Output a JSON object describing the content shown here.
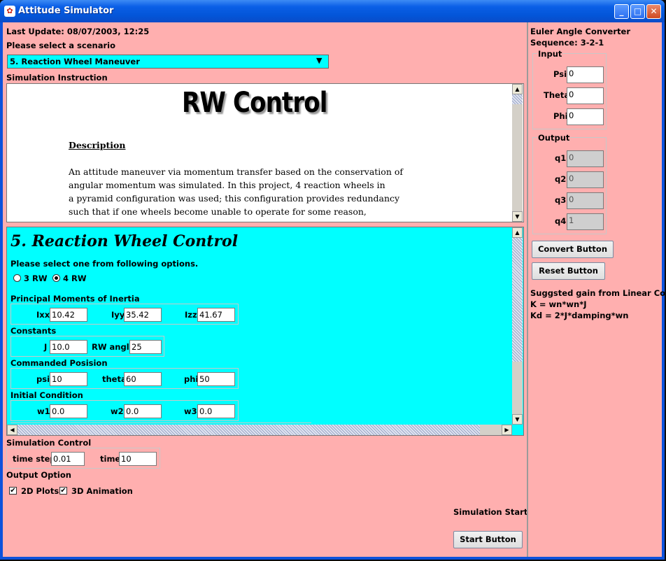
{
  "window": {
    "title": "Attitude Simulator",
    "icon": "app-icon",
    "minimize": "_",
    "maximize": "□",
    "close": "✕"
  },
  "left": {
    "last_update": "Last Update: 08/07/2003, 12:25",
    "select_prompt": "Please select a scenario",
    "scenario_selected": "5. Reaction Wheel Maneuver",
    "instruction_label": "Simulation Instruction",
    "doc": {
      "heading": "RW Control",
      "desc_title": "Description",
      "lines": [
        "An attitude maneuver via momentum transfer based on the conservation of",
        "angular momentum was simulated. In this project, 4 reaction wheels in",
        "a pyramid configuration was used; this configuration provides redundancy",
        "such that if one wheels become unable to operate for some reason,"
      ]
    },
    "panel": {
      "title": "5. Reaction Wheel Control",
      "options_prompt": "Please select one from following options.",
      "radio": [
        {
          "label": "3 RW",
          "selected": false
        },
        {
          "label": "4 RW",
          "selected": true
        }
      ],
      "inertia_title": "Principal Moments of Inertia",
      "inertia": [
        {
          "label": "Ixx",
          "value": "10.42"
        },
        {
          "label": "Iyy",
          "value": "35.42"
        },
        {
          "label": "Izz",
          "value": "41.67"
        }
      ],
      "constants_title": "Constants",
      "constants": [
        {
          "label": "J",
          "value": "10.0"
        },
        {
          "label": "RW angle",
          "value": "25"
        }
      ],
      "commanded_title": "Commanded Posision",
      "commanded": [
        {
          "label": "psi",
          "value": "10"
        },
        {
          "label": "theta",
          "value": "60"
        },
        {
          "label": "phi",
          "value": "50"
        }
      ],
      "initial_title": "Initial Condition",
      "initial": [
        {
          "label": "w1",
          "value": "0.0"
        },
        {
          "label": "w2",
          "value": "0.0"
        },
        {
          "label": "w3",
          "value": "0.0"
        }
      ]
    },
    "sim_control_title": "Simulation Control",
    "time_step_label": "time step",
    "time_step": "0.01",
    "time_label": "time",
    "time": "10",
    "output_option_title": "Output Option",
    "plots_label": "2D Plots",
    "plots_checked": true,
    "anim_label": "3D Animation",
    "anim_checked": true,
    "sim_start_label": "Simulation Start",
    "start_button": "Start Button"
  },
  "right": {
    "title": "Euler Angle Converter",
    "sequence": "Sequence: 3-2-1",
    "input_title": "Input",
    "inputs": [
      {
        "label": "Psi",
        "value": "0"
      },
      {
        "label": "Theta",
        "value": "0"
      },
      {
        "label": "Phi",
        "value": "0"
      }
    ],
    "output_title": "Output",
    "outputs": [
      {
        "label": "q1",
        "value": "0"
      },
      {
        "label": "q2",
        "value": "0"
      },
      {
        "label": "q3",
        "value": "0"
      },
      {
        "label": "q4",
        "value": "1"
      }
    ],
    "convert_button": "Convert Button",
    "reset_button": "Reset Button",
    "gain_title": "Suggsted gain from Linear Cont...",
    "gain_k": "K = wn*wn*J",
    "gain_kd": "Kd = 2*J*damping*wn"
  },
  "colors": {
    "background": "#ffafaf",
    "panel": "#00ffff",
    "select": "#00ffff",
    "titlebar": "#0a5fe6"
  }
}
